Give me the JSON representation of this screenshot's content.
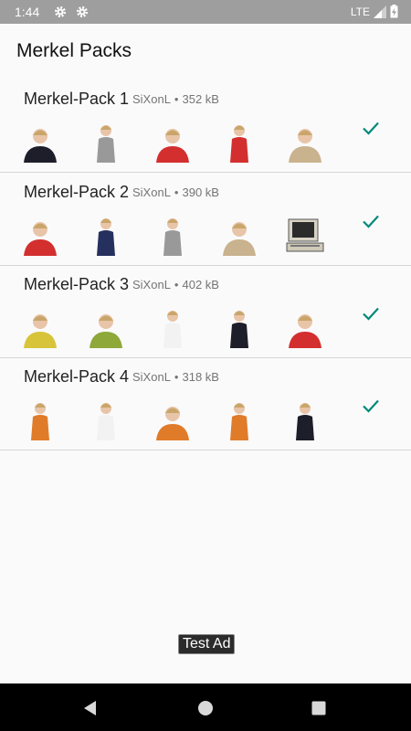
{
  "status_bar": {
    "time": "1:44",
    "network": "LTE"
  },
  "app": {
    "title": "Merkel Packs"
  },
  "packs": [
    {
      "name": "Merkel-Pack 1",
      "author": "SiXonL",
      "size": "352 kB",
      "added": true,
      "stickers": [
        "portrait-dark-jacket",
        "figure-arms-raised",
        "portrait-red-jacket",
        "figure-red-jacket",
        "portrait-beige-jacket"
      ]
    },
    {
      "name": "Merkel-Pack 2",
      "author": "SiXonL",
      "size": "390 kB",
      "added": true,
      "stickers": [
        "portrait-red-jacket",
        "figure-navy-jacket",
        "figure-podium",
        "portrait-beige-jacket",
        "retro-computer"
      ]
    },
    {
      "name": "Merkel-Pack 3",
      "author": "SiXonL",
      "size": "402 kB",
      "added": true,
      "stickers": [
        "portrait-yellow-jacket",
        "portrait-green-jacket",
        "figure-white-jacket",
        "figure-dark-jacket",
        "portrait-red-jacket"
      ]
    },
    {
      "name": "Merkel-Pack 4",
      "author": "SiXonL",
      "size": "318 kB",
      "added": true,
      "stickers": [
        "figure-orange-jacket",
        "figure-white-jacket",
        "portrait-orange-jacket",
        "figure-orange-jacket",
        "figure-dark-jacket"
      ]
    }
  ],
  "ad": {
    "label": "Test Ad"
  },
  "colors": {
    "accent": "#00897b",
    "status_bar": "#9e9e9e"
  }
}
